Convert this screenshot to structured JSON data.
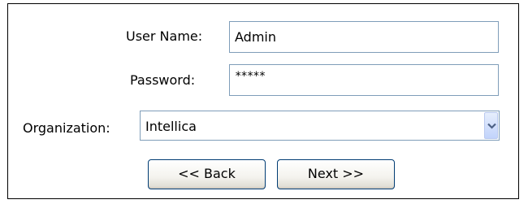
{
  "form": {
    "username_label": "User Name:",
    "username_value": "Admin",
    "password_label": "Password:",
    "password_value": "*****",
    "organization_label": "Organization:",
    "organization_value": "Intellica"
  },
  "buttons": {
    "back_label": "<< Back",
    "next_label": "Next >>"
  },
  "icons": {
    "dropdown": "chevron-down-icon"
  },
  "colors": {
    "input_border": "#7f9db9",
    "button_border": "#003c74",
    "dropdown_arrow": "#4d6185"
  }
}
